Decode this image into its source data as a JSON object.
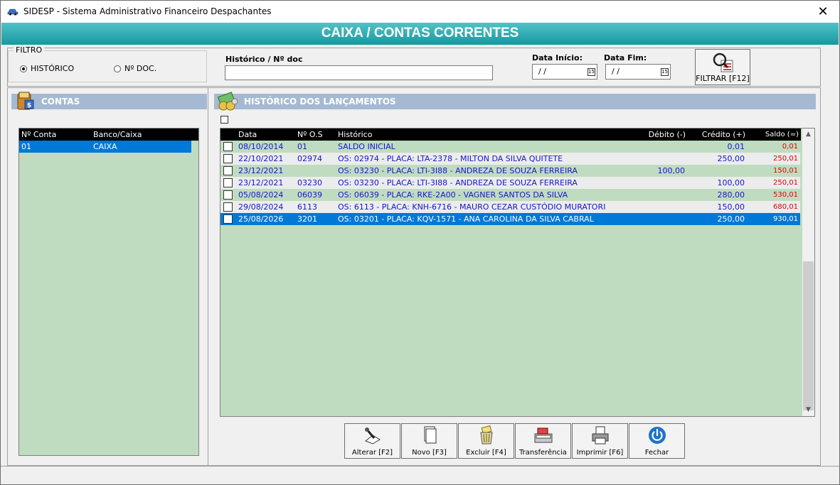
{
  "window": {
    "title": "SIDESP - Sistema Administrativo Financeiro Despachantes",
    "close_label": "✕",
    "banner": "CAIXA / CONTAS CORRENTES"
  },
  "filter": {
    "group_label": "FILTRO",
    "options": [
      "HISTÓRICO",
      "Nº DOC."
    ],
    "selected": "HISTÓRICO",
    "search_label": "Histórico / Nº doc",
    "search_value": "",
    "date_start_label": "Data Início:",
    "date_start_value": "/ /",
    "date_end_label": "Data Fim:",
    "date_end_value": "/ /",
    "calendar_label": "15",
    "filter_button": "FILTRAR [F12]"
  },
  "contas": {
    "title": "CONTAS",
    "columns": [
      "Nº Conta",
      "Banco/Caixa"
    ],
    "rows": [
      {
        "conta": "01",
        "banco": "CAIXA",
        "selected": true
      }
    ]
  },
  "historico": {
    "title": "HISTÓRICO  DOS  LANÇAMENTOS",
    "columns": [
      "Data",
      "Nº O.S",
      "Histórico",
      "Débito (-)",
      "Crédito (+)",
      "Saldo (=)"
    ],
    "rows": [
      {
        "data": "08/10/2014",
        "os": "01",
        "historico": "SALDO INICIAL",
        "debito": "",
        "credito": "0,01",
        "saldo": "0,01"
      },
      {
        "data": "22/10/2021",
        "os": "02974",
        "historico": "OS: 02974 - PLACA: LTA-2378 - MILTON DA SILVA QUITETE",
        "debito": "",
        "credito": "250,00",
        "saldo": "250,01"
      },
      {
        "data": "23/12/2021",
        "os": "",
        "historico": "OS: 03230 - PLACA: LTI-3I88 - ANDREZA DE SOUZA FERREIRA",
        "debito": "100,00",
        "credito": "",
        "saldo": "150,01"
      },
      {
        "data": "23/12/2021",
        "os": "03230",
        "historico": "OS: 03230 - PLACA: LTI-3I88 - ANDREZA DE SOUZA FERREIRA",
        "debito": "",
        "credito": "100,00",
        "saldo": "250,01"
      },
      {
        "data": "05/08/2024",
        "os": "06039",
        "historico": "OS: 06039 - PLACA: RKE-2A00 - VAGNER SANTOS DA SILVA",
        "debito": "",
        "credito": "280,00",
        "saldo": "530,01"
      },
      {
        "data": "29/08/2024",
        "os": "6113",
        "historico": "OS: 6113 - PLACA: KNH-6716 - MAURO CEZAR CUSTÓDIO MURATORI",
        "debito": "",
        "credito": "150,00",
        "saldo": "680,01"
      },
      {
        "data": "25/08/2026",
        "os": "3201",
        "historico": "OS: 03201 - PLACA: KQV-1571 - ANA CAROLINA DA SILVA CABRAL",
        "debito": "",
        "credito": "250,00",
        "saldo": "930,01",
        "selected": true
      }
    ]
  },
  "toolbar": {
    "alterar": "Alterar [F2]",
    "novo": "Novo [F3]",
    "excluir": "Excluir [F4]",
    "transferencia": "Transferência",
    "imprimir": "Imprimir [F6]",
    "fechar": "Fechar"
  },
  "colors": {
    "banner": "#17989f",
    "panel_header": "#a5bad2",
    "grid_bg": "#c0dcc0",
    "selection": "#0078d7",
    "row_text": "#1616c8",
    "saldo_text": "#e00000"
  }
}
